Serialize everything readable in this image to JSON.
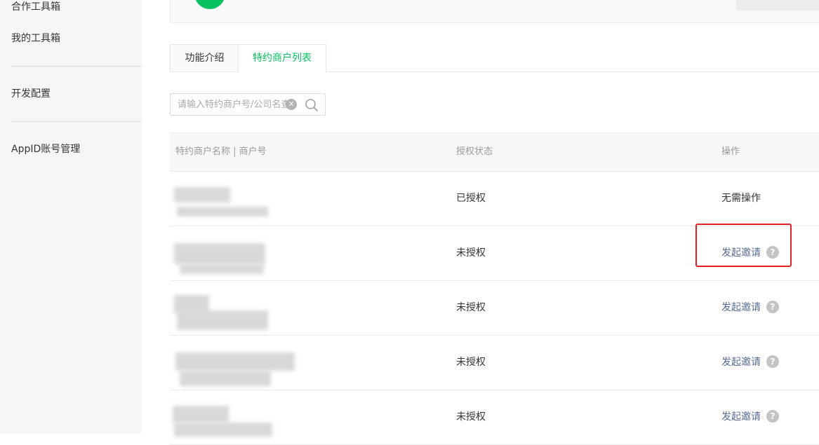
{
  "sidebar": {
    "items": [
      {
        "label": "合作工具箱"
      },
      {
        "label": "我的工具箱"
      },
      {
        "label": "开发配置"
      },
      {
        "label": "AppID账号管理"
      }
    ]
  },
  "tabs": [
    {
      "label": "功能介绍",
      "active": false
    },
    {
      "label": "特约商户列表",
      "active": true
    }
  ],
  "search": {
    "placeholder": "请输入特约商户号/公司名查",
    "value": ""
  },
  "table": {
    "headers": [
      "特约商户名称 | 商户号",
      "授权状态",
      "操作"
    ],
    "rows": [
      {
        "status": "已授权",
        "action": "无需操作",
        "action_type": "none"
      },
      {
        "status": "未授权",
        "action": "发起邀请",
        "action_type": "link"
      },
      {
        "status": "未授权",
        "action": "发起邀请",
        "action_type": "link"
      },
      {
        "status": "未授权",
        "action": "发起邀请",
        "action_type": "link"
      },
      {
        "status": "未授权",
        "action": "发起邀请",
        "action_type": "link"
      }
    ]
  },
  "colors": {
    "accent": "#07c160",
    "link": "#576b95",
    "highlight": "#e02020"
  },
  "icons": {
    "help": "?",
    "clear": "✕"
  }
}
